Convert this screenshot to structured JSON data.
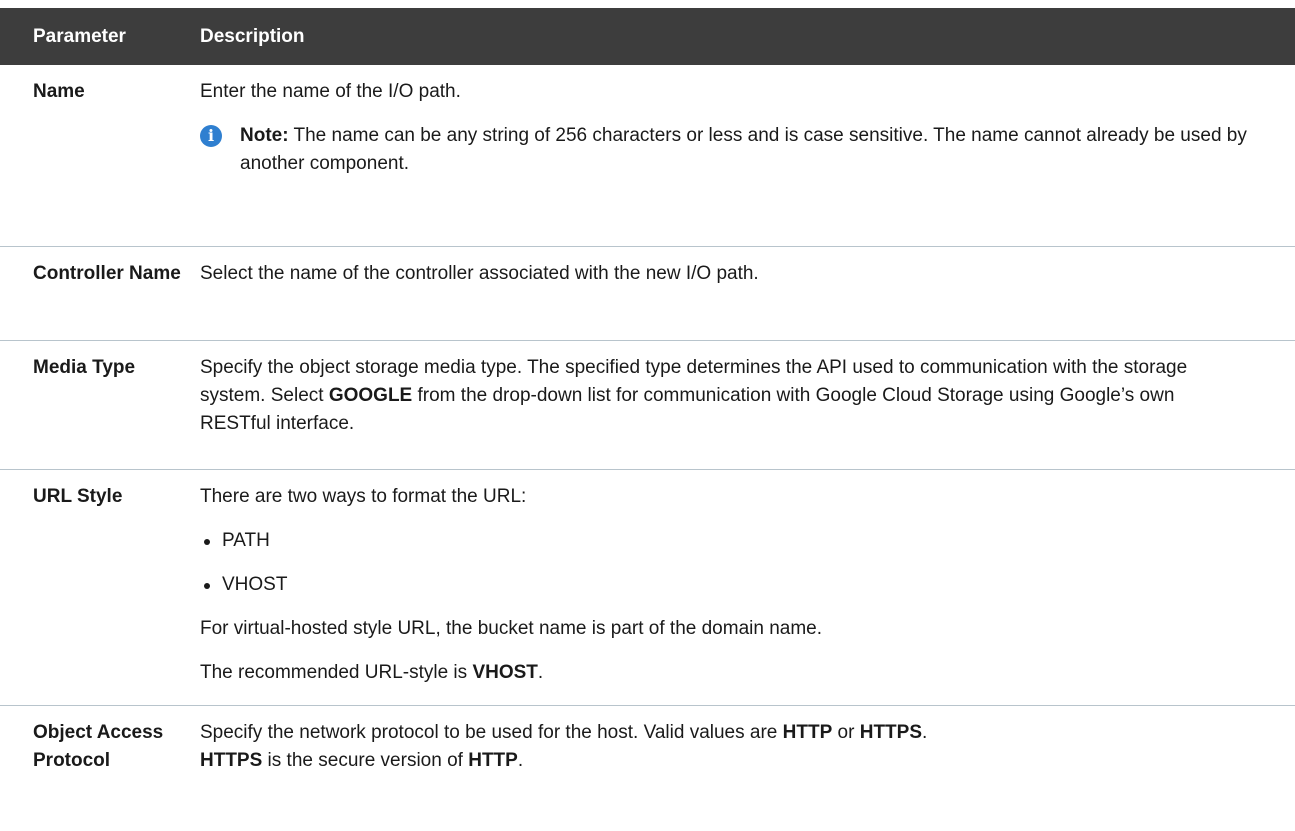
{
  "header": {
    "col_parameter": "Parameter",
    "col_description": "Description"
  },
  "rows": [
    {
      "name": "Name",
      "desc": "Enter the name of the I/O path.",
      "note_label": "Note:",
      "note_text": " The name can be any string of 256 characters or less and is case sensitive. The name cannot already be used by another component."
    },
    {
      "name": "Controller Name",
      "desc": " Select the name of the controller associated with the new I/O path."
    },
    {
      "name": "Media Type",
      "desc_pre": "Specify the object storage media type. The specified type determines the API used to communication with the storage system. Select ",
      "desc_bold": "GOOGLE",
      "desc_post": " from the drop-down list for communication with Google Cloud Storage using Google’s own RESTful interface."
    },
    {
      "name": "URL Style",
      "intro": " There are two ways to format the URL:",
      "options": [
        "PATH",
        "VHOST"
      ],
      "para": "For virtual-hosted style URL, the bucket name is part of the domain name.",
      "rec_pre": "The recommended URL-style is ",
      "rec_bold": "VHOST",
      "rec_post": "."
    },
    {
      "name": "Object Access Protocol",
      "d1": "Specify the network protocol to be used for the host. Valid values are ",
      "b1": "HTTP",
      "d2": " or ",
      "b2": "HTTPS",
      "d3": ".",
      "b3": "HTTPS",
      "d4": " is the secure version of ",
      "b4": "HTTP",
      "d5": "."
    }
  ]
}
